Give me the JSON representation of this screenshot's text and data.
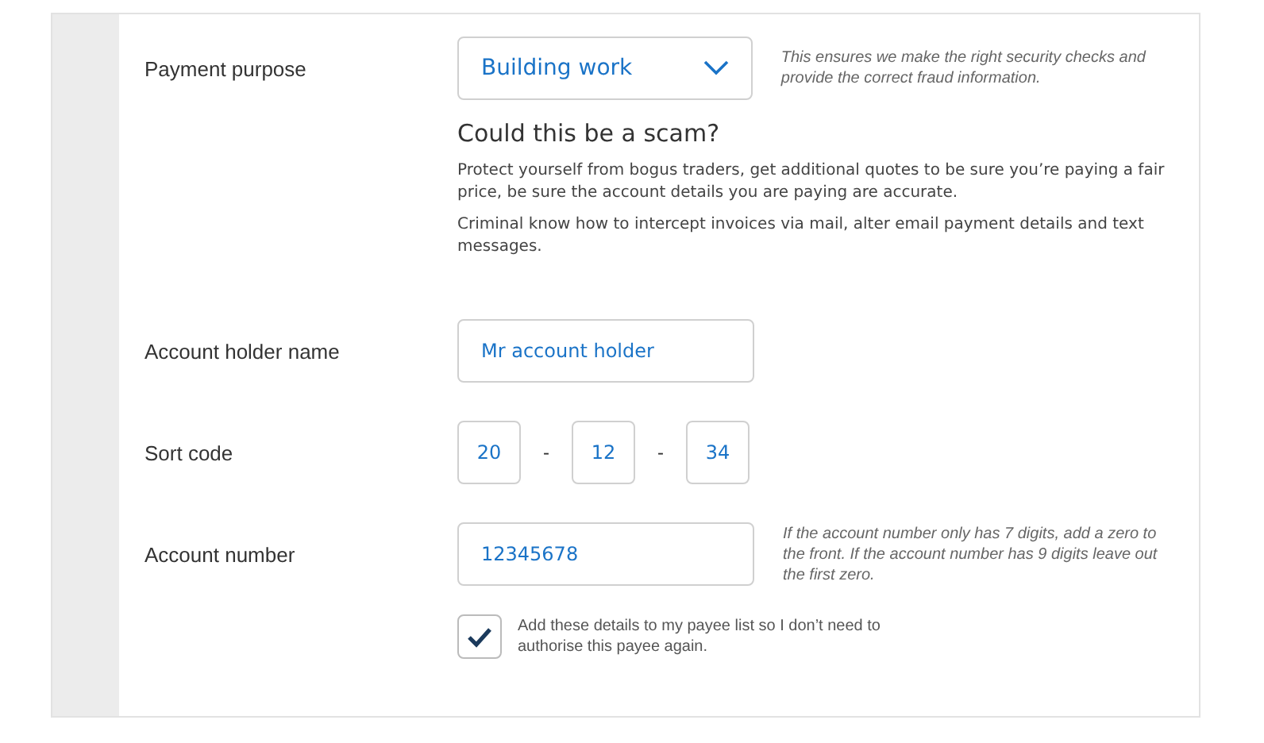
{
  "payment_purpose": {
    "label": "Payment purpose",
    "value": "Building work",
    "hint": "This ensures we make the right security checks and provide the correct fraud information."
  },
  "scam_warning": {
    "title": "Could this be a scam?",
    "paragraphs": [
      "Protect yourself from bogus traders, get additional quotes to be sure you’re paying a fair price, be sure the account details you are paying are accurate.",
      "Criminal know how to intercept invoices via mail, alter email payment details and text messages."
    ]
  },
  "account_holder": {
    "label": "Account holder name",
    "value": "Mr account holder"
  },
  "sort_code": {
    "label": "Sort code",
    "parts": [
      "20",
      "12",
      "34"
    ],
    "separators": [
      "-",
      "-"
    ]
  },
  "account_number": {
    "label": "Account number",
    "value": "12345678",
    "hint": "If the account number only has 7 digits, add a zero to the front. If the account number has 9 digits leave out the first zero."
  },
  "payee_list": {
    "label": "Add these details to my payee list so I don’t need to authorise this payee again.",
    "checked": true
  }
}
